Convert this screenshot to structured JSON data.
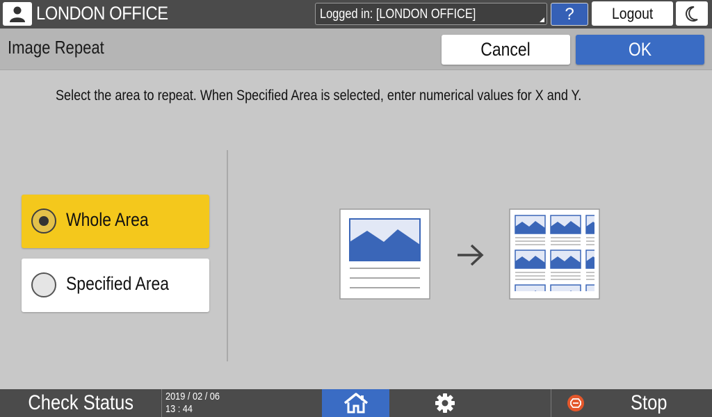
{
  "topbar": {
    "user_icon": "user-icon",
    "office_name": "LONDON OFFICE",
    "login_status": "Logged in: [LONDON OFFICE]",
    "help_label": "?",
    "logout_label": "Logout",
    "night_mode_icon": "moon-icon"
  },
  "header": {
    "title": "Image Repeat",
    "cancel_label": "Cancel",
    "ok_label": "OK"
  },
  "main": {
    "instruction": "Select the area to repeat. When Specified Area is selected, enter numerical values for X and Y.",
    "options": [
      {
        "label": "Whole Area",
        "selected": true
      },
      {
        "label": "Specified Area",
        "selected": false
      }
    ],
    "illustration": {
      "source_icon": "single-image-page-icon",
      "arrow_icon": "arrow-right-icon",
      "result_icon": "repeated-image-page-icon"
    }
  },
  "bottombar": {
    "check_status_label": "Check Status",
    "date": "2019 / 02 / 06",
    "time": "13 : 44",
    "home_icon": "home-icon",
    "settings_icon": "gear-icon",
    "stop_label": "Stop",
    "stop_icon": "stop-icon"
  },
  "colors": {
    "topbar_bg": "#4b4b4b",
    "accent_blue": "#3a6cc4",
    "selected_yellow": "#f4c81c",
    "stop_orange": "#e4572b"
  }
}
